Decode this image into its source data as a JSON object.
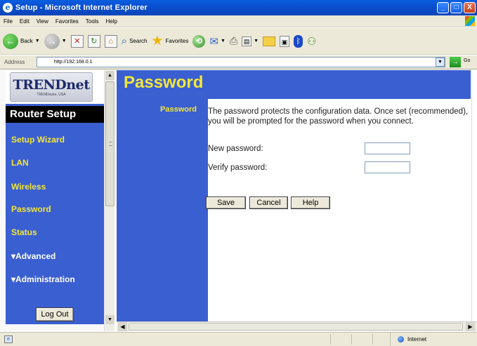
{
  "window": {
    "title": "Setup - Microsoft Internet Explorer",
    "minimize_glyph": "_",
    "maximize_glyph": "□",
    "close_glyph": "X"
  },
  "menu": [
    "File",
    "Edit",
    "View",
    "Favorites",
    "Tools",
    "Help"
  ],
  "toolbar": {
    "back_label": "Back",
    "search_label": "Search",
    "favorites_label": "Favorites"
  },
  "address": {
    "label": "Address",
    "url": "http://192.168.0.1",
    "go_label": "Go"
  },
  "sidebar": {
    "logo_text": "TRENDnet",
    "logo_sub": "TRENDware, USA",
    "section_title": "Router Setup",
    "items": [
      {
        "label": "Setup Wizard"
      },
      {
        "label": "LAN"
      },
      {
        "label": "Wireless"
      },
      {
        "label": "Password"
      },
      {
        "label": "Status"
      },
      {
        "label": "▾Advanced"
      },
      {
        "label": "▾Administration"
      }
    ],
    "logout_label": "Log Out"
  },
  "main": {
    "page_title": "Password",
    "section_label": "Password",
    "description": "The password protects the configuration data. Once set (recommended), you will be prompted for the password when you connect.",
    "new_password_label": "New password:",
    "verify_password_label": "Verify password:",
    "new_password_value": "",
    "verify_password_value": "",
    "save_label": "Save",
    "cancel_label": "Cancel",
    "help_label": "Help"
  },
  "status": {
    "zone": "Internet"
  },
  "colors": {
    "frame_blue": "#3a5fd0",
    "nav_yellow": "#f3e63a",
    "xp_title_blue": "#0a4fd0"
  }
}
